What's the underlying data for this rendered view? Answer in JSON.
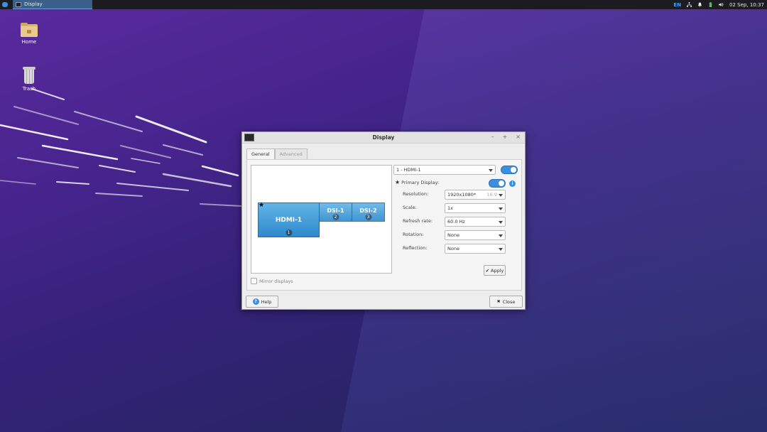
{
  "panel": {
    "task_title": "Display",
    "lang": "EN",
    "datetime": "02 Sep, 10:37"
  },
  "desktop": {
    "icons": [
      {
        "label": "Home"
      },
      {
        "label": "Trash"
      }
    ]
  },
  "dialog": {
    "title": "Display",
    "window_buttons": {
      "minimize": "–",
      "maximize": "+",
      "close": "×"
    },
    "tabs": [
      {
        "label": "General",
        "active": true
      },
      {
        "label": "Advanced",
        "active": false
      }
    ],
    "monitors": [
      {
        "name": "HDMI-1",
        "number": "1",
        "primary": true
      },
      {
        "name": "DSI-1",
        "number": "2"
      },
      {
        "name": "DSI-2",
        "number": "3"
      }
    ],
    "primary_mark": "★",
    "mirror_label": "Mirror displays",
    "display_select": "1 - HDMI-1",
    "primary_label": "Primary Display:",
    "primary_star": "★",
    "info": "i",
    "settings": {
      "resolution_label": "Resolution:",
      "resolution_value": "1920x1080*",
      "resolution_aspect": "16:9",
      "scale_label": "Scale:",
      "scale_value": "1x",
      "refresh_label": "Refresh rate:",
      "refresh_value": "60.0 Hz",
      "rotation_label": "Rotation:",
      "rotation_value": "None",
      "reflection_label": "Reflection:",
      "reflection_value": "None"
    },
    "apply_label": "Apply",
    "apply_icon": "✔",
    "help_label": "Help",
    "help_icon": "?",
    "close_label": "Close",
    "close_icon": "✖"
  },
  "colors": {
    "accent": "#3b8fe0",
    "monitor": "#2e8acb"
  }
}
